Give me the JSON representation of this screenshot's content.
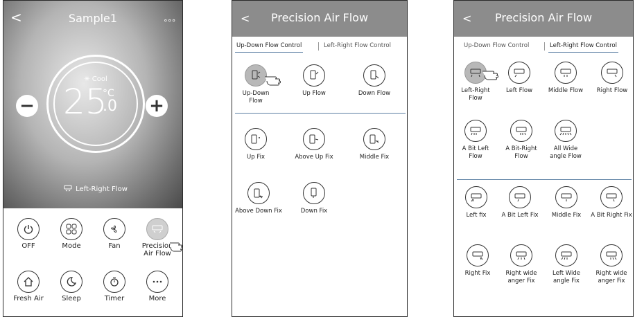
{
  "panel1": {
    "title": "Sample1",
    "back": "<",
    "more": "∘∘∘",
    "mode_label": "✳ Cool",
    "temp": "25",
    "temp_decimal": ".0",
    "unit": "°C",
    "minus": "−",
    "plus": "+",
    "flow_status": "Left-Right Flow",
    "functions": [
      {
        "label": "OFF"
      },
      {
        "label": "Mode"
      },
      {
        "label": "Fan"
      },
      {
        "label": "Precision Air Flow"
      },
      {
        "label": "Fresh Air"
      },
      {
        "label": "Sleep"
      },
      {
        "label": "Timer"
      },
      {
        "label": "More"
      }
    ]
  },
  "panel2": {
    "back": "<",
    "title": "Precision Air Flow",
    "tabs": [
      "Up-Down Flow Control",
      "Left-Right Flow Control"
    ],
    "options": [
      "Up-Down Flow",
      "Up Flow",
      "Down Flow",
      "Up Fix",
      "Above Up Fix",
      "Middle Fix",
      "Above Down Fix",
      "Down Fix"
    ]
  },
  "panel3": {
    "back": "<",
    "title": "Precision Air Flow",
    "tabs": [
      "Up-Down Flow Control",
      "Left-Right Flow Control"
    ],
    "options": [
      "Left-Right Flow",
      "Left Flow",
      "Middle Flow",
      "Right Flow",
      "A Bit Left Flow",
      "A Bit-Right Flow",
      "All Wide angle Flow",
      "Left fix",
      "A Bit Left Fix",
      "Middle Fix",
      "A Bit Right Fix",
      "Right Fix",
      "Right wide anger Fix",
      "Left Wide angle Fix",
      "Right wide anger Fix"
    ]
  },
  "colors": {
    "header": "#8c8c8c",
    "accent_line": "#5a7ea2"
  }
}
